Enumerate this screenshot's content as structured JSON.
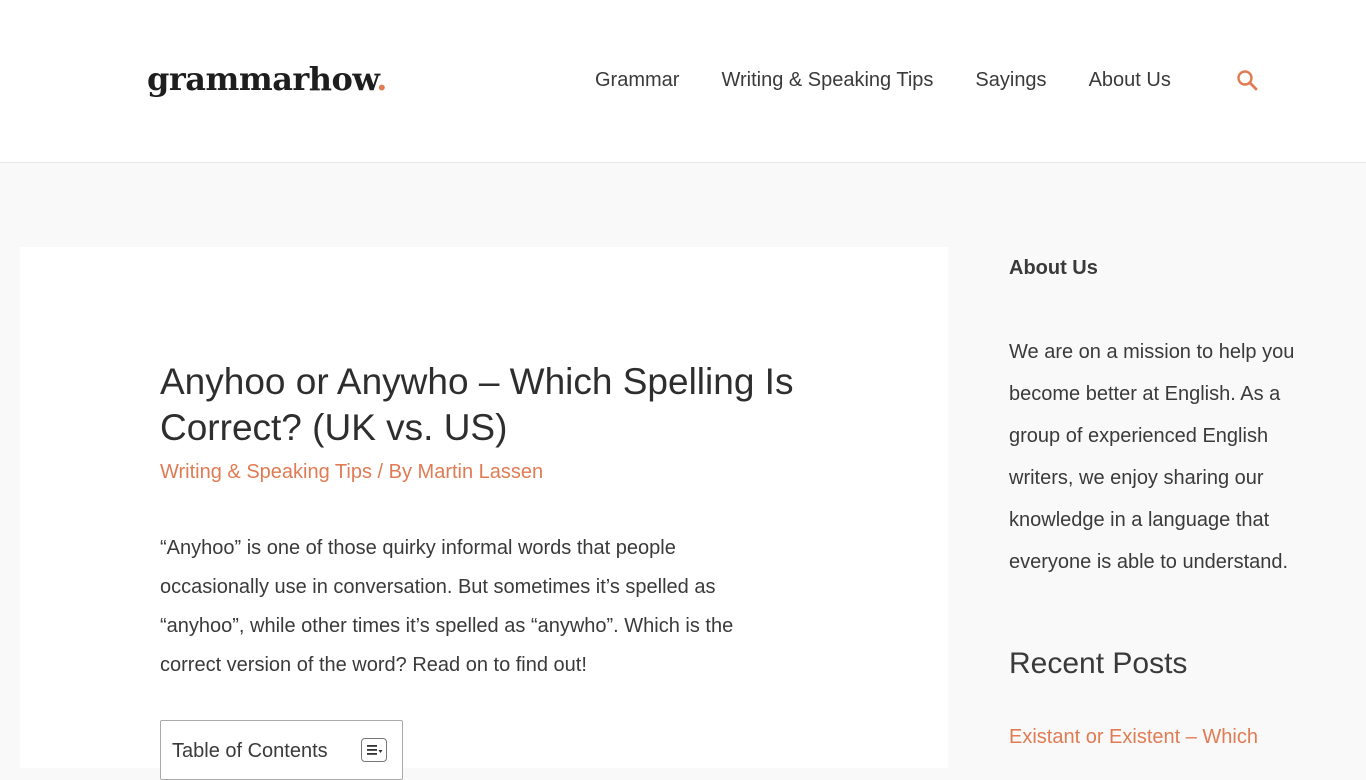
{
  "header": {
    "logo_text": "grammarhow",
    "logo_dot": ".",
    "nav": [
      "Grammar",
      "Writing & Speaking Tips",
      "Sayings",
      "About Us"
    ]
  },
  "colors": {
    "accent": "#e07b53",
    "text": "#3a3a3a",
    "background": "#f9f9f9"
  },
  "icons": {
    "search": "search-icon",
    "toc_toggle": "list-toggle-icon"
  },
  "article": {
    "title": "Anyhoo or Anywho – Which Spelling Is Correct? (UK vs. US)",
    "category": "Writing & Speaking Tips",
    "separator": " / By ",
    "author": "Martin Lassen",
    "intro": "“Anyhoo” is one of those quirky informal words that people occasionally use in conversation. But sometimes it’s spelled as “anyhoo”, while other times it’s spelled as “anywho”. Which is the correct version of the word? Read on to find out!",
    "toc_title": "Table of Contents"
  },
  "sidebar": {
    "about_heading": "About Us",
    "about_text": "We are on a mission to help you become better at English. As a group of experienced English writers, we enjoy sharing our knowledge in a language that everyone is able to understand.",
    "recent_heading": "Recent Posts",
    "recent_posts": [
      "Existant or Existent – Which"
    ]
  }
}
